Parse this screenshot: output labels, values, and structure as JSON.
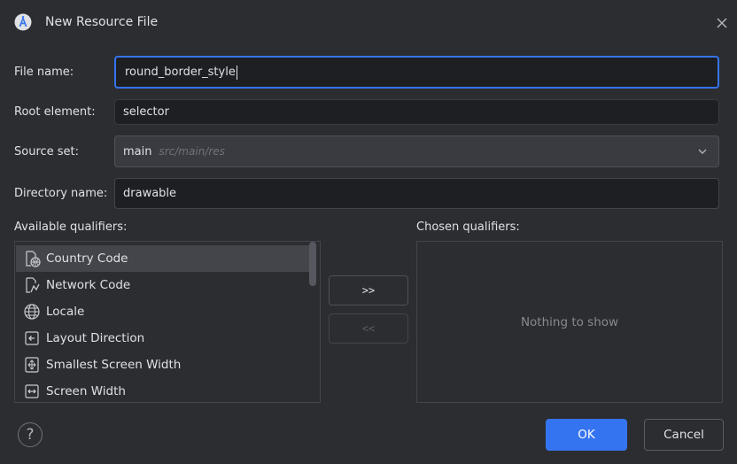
{
  "window": {
    "title": "New Resource File"
  },
  "form": {
    "file_name_label": "File name:",
    "file_name_value": "round_border_style",
    "root_element_label": "Root element:",
    "root_element_value": "selector",
    "source_set_label": "Source set:",
    "source_set_value": "main",
    "source_set_hint": "src/main/res",
    "directory_name_label": "Directory name:",
    "directory_name_value": "drawable"
  },
  "qualifiers": {
    "available_label": "Available qualifiers:",
    "chosen_label": "Chosen qualifiers:",
    "available_items": [
      {
        "label": "Country Code",
        "icon": "country-code-icon",
        "selected": true
      },
      {
        "label": "Network Code",
        "icon": "network-code-icon",
        "selected": false
      },
      {
        "label": "Locale",
        "icon": "globe-icon",
        "selected": false
      },
      {
        "label": "Layout Direction",
        "icon": "layout-direction-icon",
        "selected": false
      },
      {
        "label": "Smallest Screen Width",
        "icon": "smallest-screen-width-icon",
        "selected": false
      },
      {
        "label": "Screen Width",
        "icon": "screen-width-icon",
        "selected": false
      }
    ],
    "add_button": ">>",
    "remove_button": "<<",
    "empty_text": "Nothing to show"
  },
  "footer": {
    "help": "?",
    "ok_label": "OK",
    "cancel_label": "Cancel"
  },
  "colors": {
    "background": "#2b2d30",
    "accent": "#3574f0",
    "field_bg": "#1e1f22",
    "selected_row": "#43454a"
  }
}
